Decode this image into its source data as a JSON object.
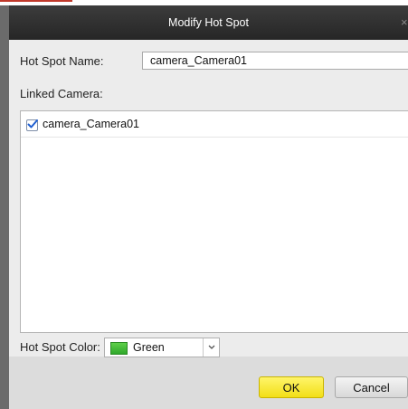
{
  "dialog": {
    "title": "Modify Hot Spot",
    "close_glyph": "×"
  },
  "form": {
    "name_label": "Hot Spot Name:",
    "name_value": "camera_Camera01",
    "linked_label": "Linked Camera:",
    "cameras": [
      {
        "label": "camera_Camera01",
        "checked": true
      }
    ],
    "color_label": "Hot Spot Color:",
    "color_value": "Green",
    "color_hex": "#3cbf32"
  },
  "buttons": {
    "ok_label": "OK",
    "cancel_label": "Cancel"
  },
  "icons": {
    "close": "close-icon",
    "checkbox": "checkmark-icon",
    "dropdown": "chevron-down-icon"
  }
}
